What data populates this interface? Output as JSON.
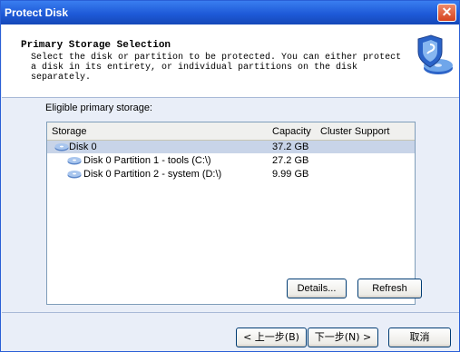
{
  "window": {
    "title": "Protect Disk"
  },
  "header": {
    "title": "Primary Storage Selection",
    "description": "Select the disk or partition to be protected. You can either protect a disk in its entirety, or individual partitions on the disk separately."
  },
  "storage": {
    "label": "Eligible primary storage:",
    "columns": [
      "Storage",
      "Capacity",
      "Cluster Support"
    ],
    "rows": [
      {
        "name": "Disk 0",
        "capacity": "37.2 GB",
        "selected": true
      },
      {
        "name": "Disk 0 Partition 1 - tools (C:\\)",
        "capacity": "27.2 GB",
        "selected": false
      },
      {
        "name": "Disk 0 Partition 2 - system (D:\\)",
        "capacity": "9.99 GB",
        "selected": false
      }
    ]
  },
  "buttons": {
    "details": "Details...",
    "refresh": "Refresh",
    "back": "< 上一步(B)",
    "next": "下一步(N) >",
    "cancel": "取消"
  },
  "colors": {
    "titlebar": "#1e5ad8",
    "selection": "#c8d4e8",
    "dialog_bg": "#e9eef8"
  }
}
